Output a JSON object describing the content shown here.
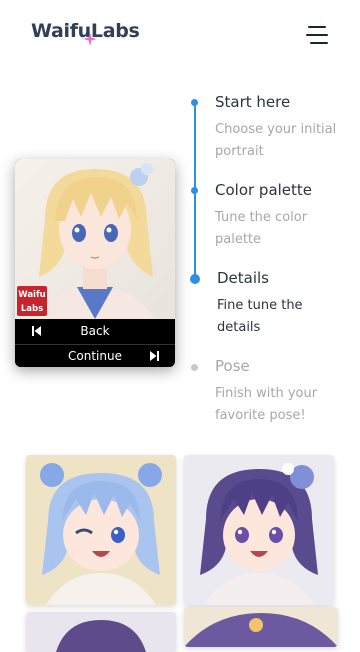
{
  "header": {
    "logo_text": "WaifuLabs",
    "menu_icon": "hamburger-menu-icon"
  },
  "steps": [
    {
      "title": "Start here",
      "desc": "Choose your initial portrait",
      "state": "done"
    },
    {
      "title": "Color palette",
      "desc": "Tune the color palette",
      "state": "done"
    },
    {
      "title": "Details",
      "desc": "Fine tune the details",
      "state": "current"
    },
    {
      "title": "Pose",
      "desc": "Finish with your favorite pose!",
      "state": "upcoming"
    }
  ],
  "card": {
    "badge_line1": "Waifu",
    "badge_line2": "Labs",
    "back_label": "Back",
    "continue_label": "Continue"
  },
  "colors": {
    "accent": "#2b8fe6",
    "badge": "#c8242b",
    "text_dark": "#2b3440",
    "text_muted": "#a7a7a7"
  }
}
